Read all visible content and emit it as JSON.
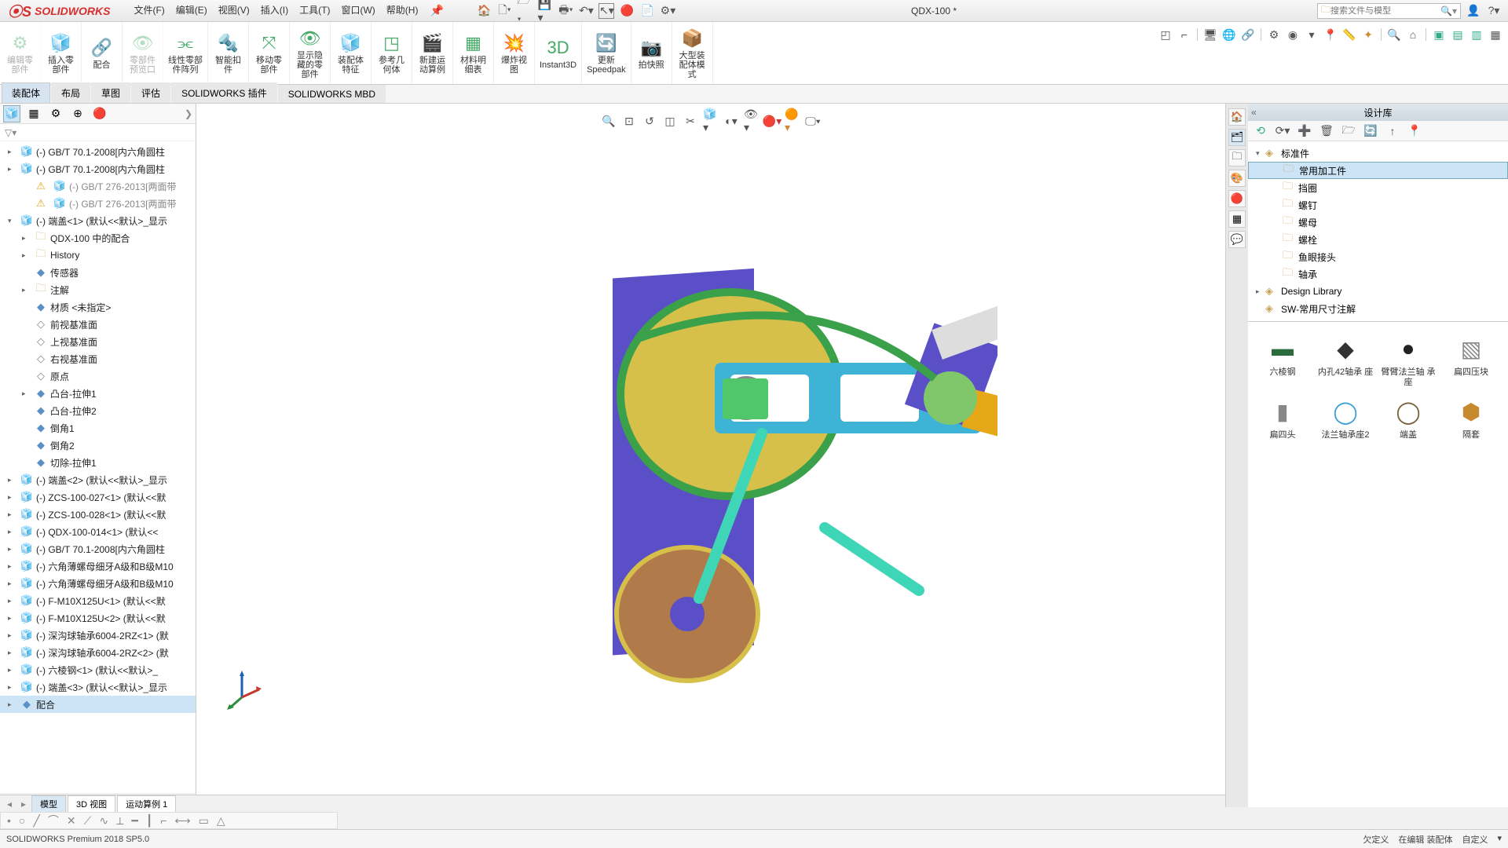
{
  "app": {
    "brand": "SOLIDWORKS",
    "doc_title": "QDX-100 *"
  },
  "menu": {
    "file": "文件(F)",
    "edit": "编辑(E)",
    "view": "视图(V)",
    "insert": "插入(I)",
    "tools": "工具(T)",
    "window": "窗口(W)",
    "help": "帮助(H)"
  },
  "search": {
    "placeholder": "搜索文件与模型"
  },
  "ribbon": [
    {
      "label": "编辑零\n部件",
      "disabled": true
    },
    {
      "label": "插入零\n部件"
    },
    {
      "label": "配合"
    },
    {
      "label": "零部件\n预览口",
      "disabled": true
    },
    {
      "label": "线性零部\n件阵列"
    },
    {
      "label": "智能扣\n件"
    },
    {
      "label": "移动零\n部件"
    },
    {
      "label": "显示隐\n藏的零\n部件"
    },
    {
      "label": "装配体\n特征"
    },
    {
      "label": "参考几\n何体"
    },
    {
      "label": "新建运\n动算例"
    },
    {
      "label": "材料明\n细表"
    },
    {
      "label": "爆炸视\n图"
    },
    {
      "label": "Instant3D"
    },
    {
      "label": "更新\nSpeedpak"
    },
    {
      "label": "拍快照"
    },
    {
      "label": "大型装\n配体模\n式"
    }
  ],
  "doc_tabs": [
    {
      "label": "装配体",
      "active": true
    },
    {
      "label": "布局"
    },
    {
      "label": "草图"
    },
    {
      "label": "评估"
    },
    {
      "label": "SOLIDWORKS 插件"
    },
    {
      "label": "SOLIDWORKS MBD"
    }
  ],
  "tree": [
    {
      "d": 0,
      "t": "▸",
      "ic": "ic-part",
      "txt": "(-) GB/T 70.1-2008[内六角圆柱"
    },
    {
      "d": 0,
      "t": "▸",
      "ic": "ic-part",
      "txt": "(-) GB/T 70.1-2008[内六角圆柱"
    },
    {
      "d": 1,
      "t": "",
      "ic": "ic-gray",
      "warn": true,
      "txt": "(-) GB/T 276-2013[两面带",
      "dim": true
    },
    {
      "d": 1,
      "t": "",
      "ic": "ic-gray",
      "warn": true,
      "txt": "(-) GB/T 276-2013[两面带",
      "dim": true
    },
    {
      "d": 0,
      "t": "▾",
      "ic": "ic-part",
      "txt": "(-) 端盖<1> (默认<<默认>_显示"
    },
    {
      "d": 1,
      "t": "▸",
      "ic": "ic-folder",
      "txt": "QDX-100 中的配合"
    },
    {
      "d": 1,
      "t": "▸",
      "ic": "ic-folder",
      "txt": "History"
    },
    {
      "d": 1,
      "t": "",
      "ic": "ic-feat",
      "txt": "传感器"
    },
    {
      "d": 1,
      "t": "▸",
      "ic": "ic-folder",
      "txt": "注解"
    },
    {
      "d": 1,
      "t": "",
      "ic": "ic-feat",
      "txt": "材质 <未指定>"
    },
    {
      "d": 1,
      "t": "",
      "ic": "ic-plane",
      "txt": "前视基准面"
    },
    {
      "d": 1,
      "t": "",
      "ic": "ic-plane",
      "txt": "上视基准面"
    },
    {
      "d": 1,
      "t": "",
      "ic": "ic-plane",
      "txt": "右视基准面"
    },
    {
      "d": 1,
      "t": "",
      "ic": "ic-plane",
      "txt": "原点"
    },
    {
      "d": 1,
      "t": "▸",
      "ic": "ic-feat",
      "txt": "凸台-拉伸1"
    },
    {
      "d": 1,
      "t": "",
      "ic": "ic-feat",
      "txt": "凸台-拉伸2"
    },
    {
      "d": 1,
      "t": "",
      "ic": "ic-feat",
      "txt": "倒角1"
    },
    {
      "d": 1,
      "t": "",
      "ic": "ic-feat",
      "txt": "倒角2"
    },
    {
      "d": 1,
      "t": "",
      "ic": "ic-feat",
      "txt": "切除-拉伸1"
    },
    {
      "d": 0,
      "t": "▸",
      "ic": "ic-part",
      "txt": "(-) 端盖<2> (默认<<默认>_显示"
    },
    {
      "d": 0,
      "t": "▸",
      "ic": "ic-part",
      "txt": "(-) ZCS-100-027<1> (默认<<默"
    },
    {
      "d": 0,
      "t": "▸",
      "ic": "ic-part",
      "txt": "(-) ZCS-100-028<1> (默认<<默"
    },
    {
      "d": 0,
      "t": "▸",
      "ic": "ic-part",
      "txt": "(-) QDX-100-014<1> (默认<<"
    },
    {
      "d": 0,
      "t": "▸",
      "ic": "ic-part",
      "txt": "(-) GB/T 70.1-2008[内六角圆柱"
    },
    {
      "d": 0,
      "t": "▸",
      "ic": "ic-part",
      "txt": "(-) 六角薄螺母细牙A级和B级M10"
    },
    {
      "d": 0,
      "t": "▸",
      "ic": "ic-part",
      "txt": "(-) 六角薄螺母细牙A级和B级M10"
    },
    {
      "d": 0,
      "t": "▸",
      "ic": "ic-part",
      "txt": "(-) F-M10X125U<1> (默认<<默"
    },
    {
      "d": 0,
      "t": "▸",
      "ic": "ic-part",
      "txt": "(-) F-M10X125U<2> (默认<<默"
    },
    {
      "d": 0,
      "t": "▸",
      "ic": "ic-part",
      "txt": "(-) 深沟球轴承6004-2RZ<1> (默"
    },
    {
      "d": 0,
      "t": "▸",
      "ic": "ic-part",
      "txt": "(-) 深沟球轴承6004-2RZ<2> (默"
    },
    {
      "d": 0,
      "t": "▸",
      "ic": "ic-part",
      "txt": "(-) 六棱钢<1> (默认<<默认>_"
    },
    {
      "d": 0,
      "t": "▸",
      "ic": "ic-part",
      "txt": "(-) 端盖<3> (默认<<默认>_显示"
    },
    {
      "d": 0,
      "t": "▸",
      "ic": "ic-feat",
      "txt": "配合",
      "sel": true
    }
  ],
  "bottom_tabs": [
    {
      "label": "模型",
      "active": true
    },
    {
      "label": "3D 视图"
    },
    {
      "label": "运动算例 1"
    }
  ],
  "design_library": {
    "title": "设计库",
    "tree": [
      {
        "d": 0,
        "t": "▾",
        "ic": "◈",
        "txt": "标准件"
      },
      {
        "d": 1,
        "t": "",
        "ic": "🗀",
        "txt": "常用加工件",
        "sel": true
      },
      {
        "d": 1,
        "t": "",
        "ic": "🗀",
        "txt": "挡圈"
      },
      {
        "d": 1,
        "t": "",
        "ic": "🗀",
        "txt": "螺钉"
      },
      {
        "d": 1,
        "t": "",
        "ic": "🗀",
        "txt": "螺母"
      },
      {
        "d": 1,
        "t": "",
        "ic": "🗀",
        "txt": "螺栓"
      },
      {
        "d": 1,
        "t": "",
        "ic": "🗀",
        "txt": "鱼眼接头"
      },
      {
        "d": 1,
        "t": "",
        "ic": "🗀",
        "txt": "轴承"
      },
      {
        "d": 0,
        "t": "▸",
        "ic": "◈",
        "txt": "Design Library"
      },
      {
        "d": 0,
        "t": "",
        "ic": "◈",
        "txt": "SW-常用尺寸注解"
      }
    ],
    "thumbs": [
      {
        "label": "六棱钢",
        "glyph": "▬",
        "color": "#2a6b3e"
      },
      {
        "label": "内孔42轴承\n座",
        "glyph": "◆",
        "color": "#333"
      },
      {
        "label": "臂臂法兰轴\n承座",
        "glyph": "●",
        "color": "#222"
      },
      {
        "label": "扁四压块",
        "glyph": "▧",
        "color": "#888"
      },
      {
        "label": "扁四头",
        "glyph": "▮",
        "color": "#888"
      },
      {
        "label": "法兰轴承座2",
        "glyph": "◯",
        "color": "#3aa0d8"
      },
      {
        "label": "端盖",
        "glyph": "◯",
        "color": "#7a5e3a"
      },
      {
        "label": "隔套",
        "glyph": "⬢",
        "color": "#c78a2e"
      }
    ]
  },
  "status": {
    "version": "SOLIDWORKS Premium 2018 SP5.0",
    "r1": "欠定义",
    "r2": "在编辑 装配体",
    "r3": "自定义"
  }
}
